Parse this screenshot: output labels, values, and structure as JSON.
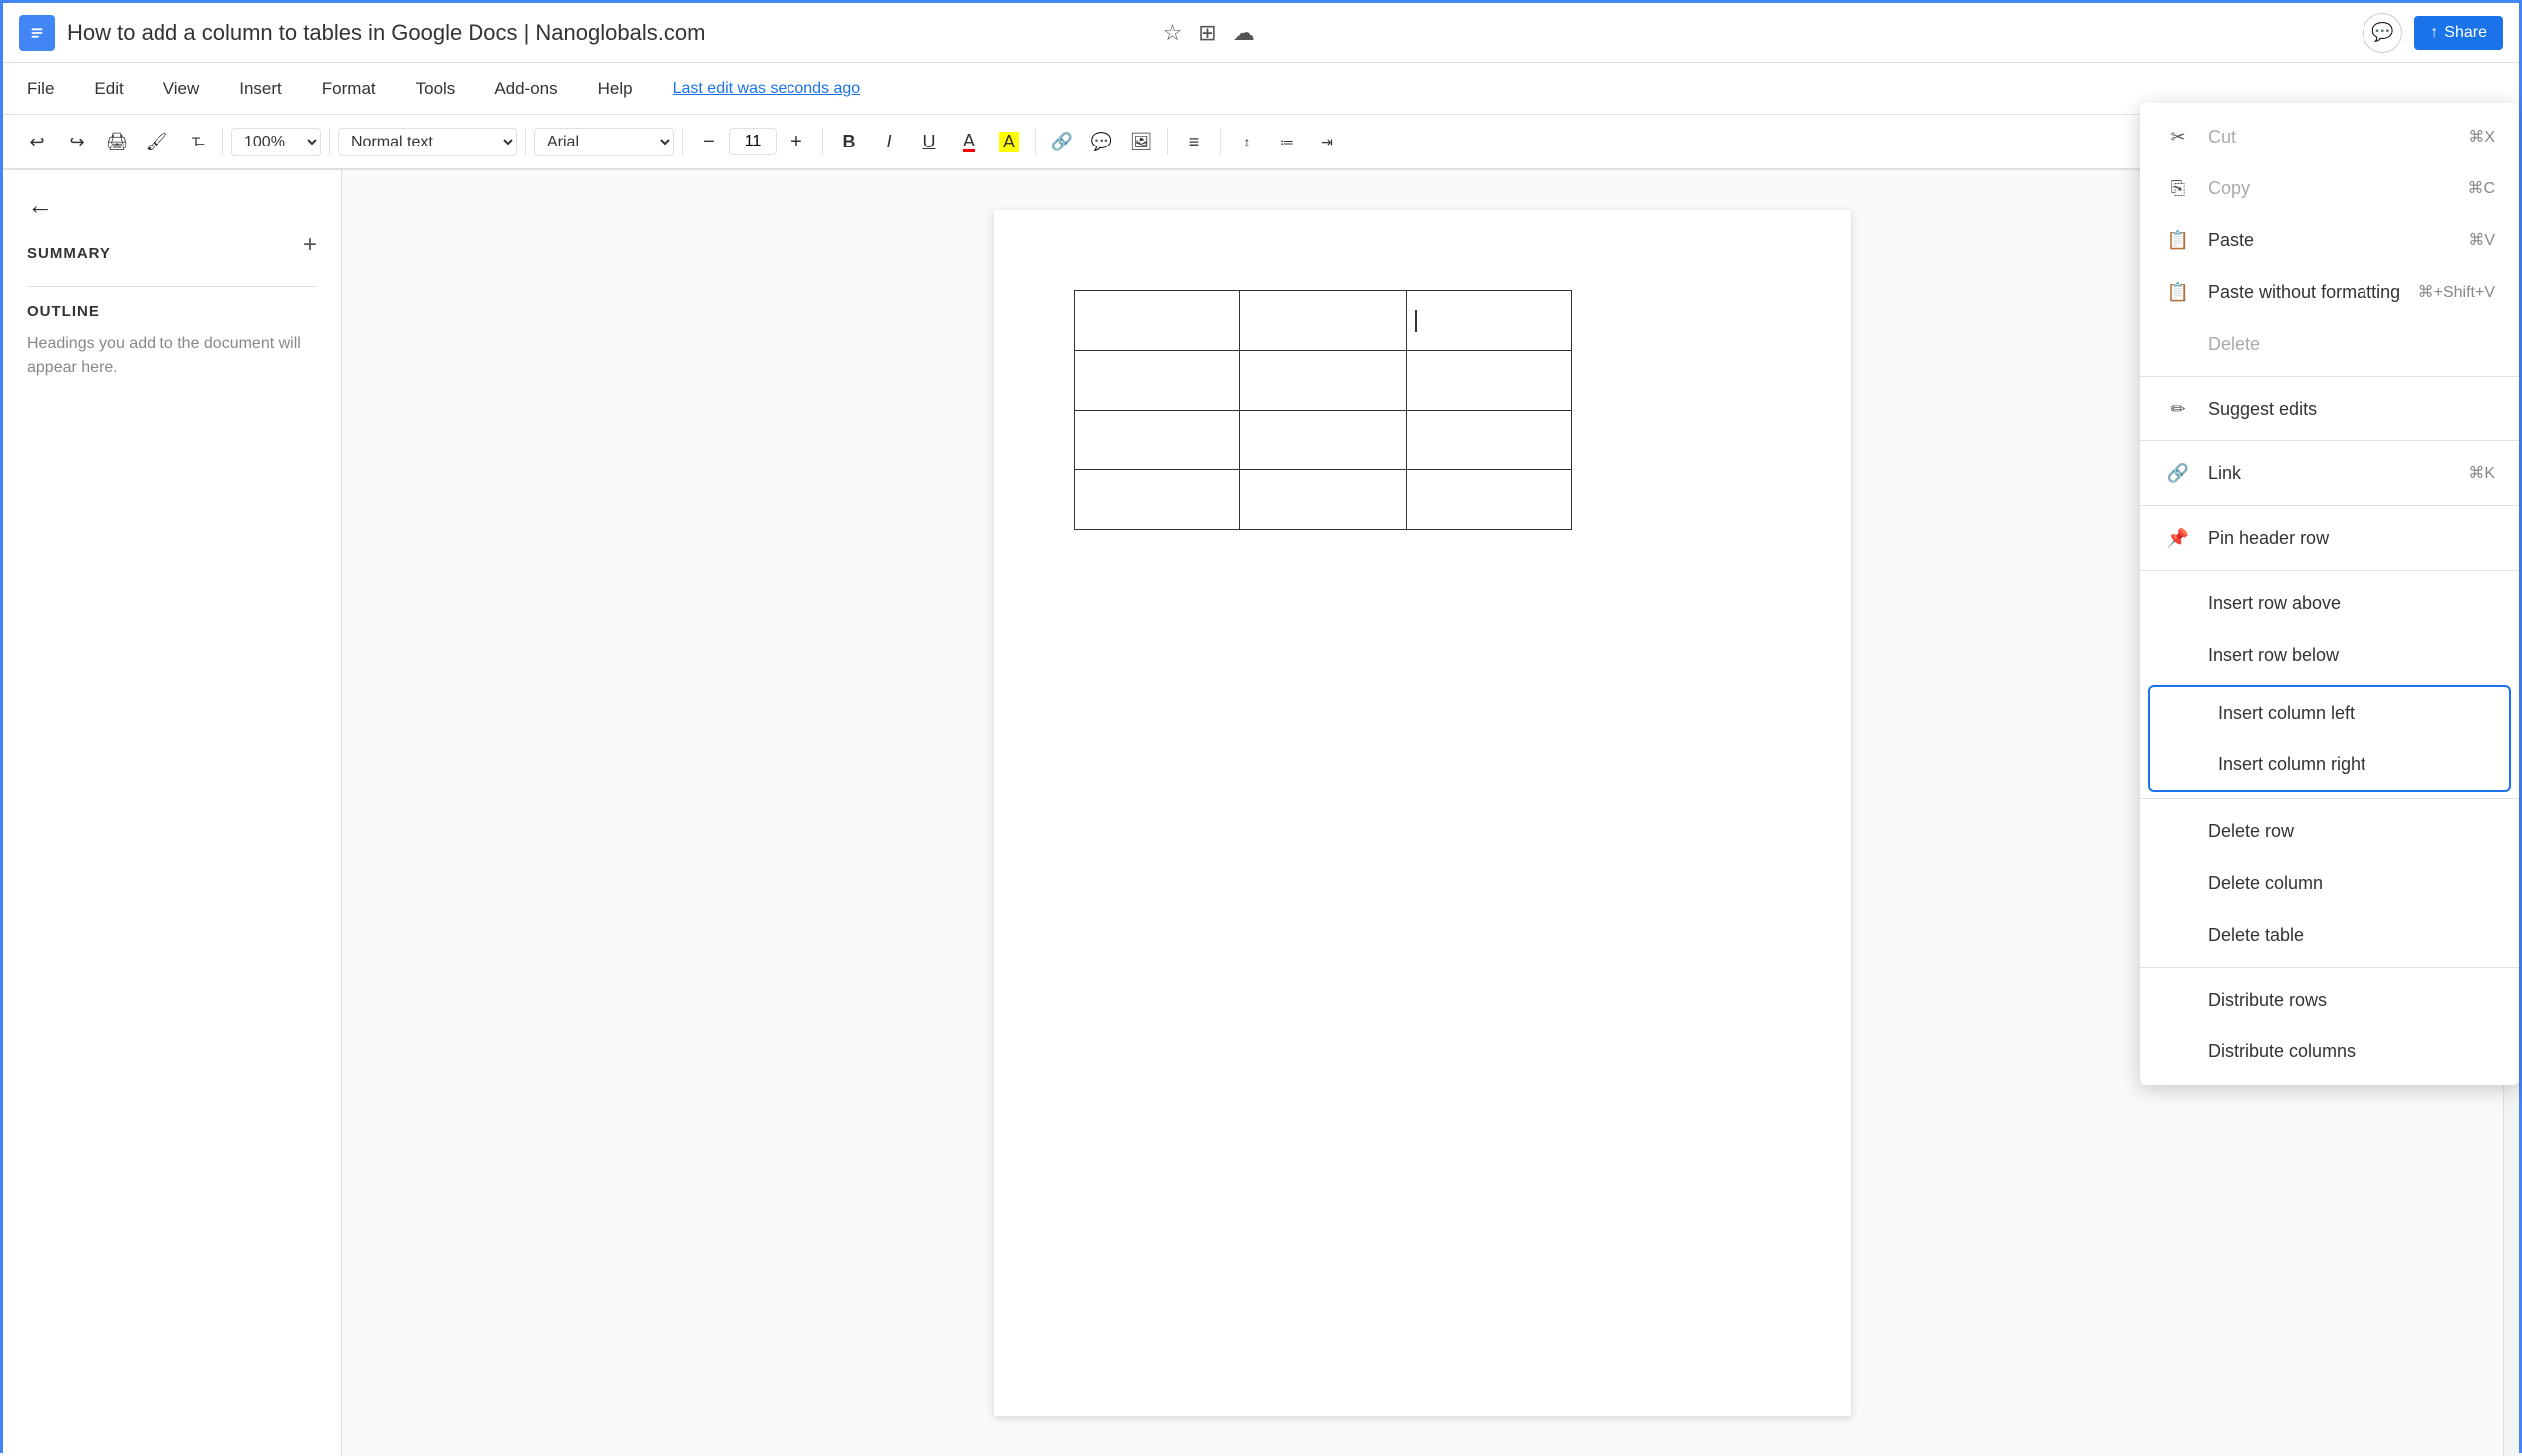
{
  "window": {
    "title": "How to add a column to tables in Google Docs | Nanoglobals.com",
    "last_edit": "Last edit was seconds ago"
  },
  "menubar": {
    "items": [
      "File",
      "Edit",
      "View",
      "Insert",
      "Format",
      "Tools",
      "Add-ons",
      "Help"
    ]
  },
  "toolbar": {
    "zoom": "100%",
    "style": "Normal text",
    "font": "Arial",
    "font_size": "11",
    "undo_label": "↩",
    "redo_label": "↪"
  },
  "sidebar": {
    "summary_label": "SUMMARY",
    "outline_label": "OUTLINE",
    "outline_hint": "Headings you add to the document will appear here."
  },
  "context_menu": {
    "items": [
      {
        "id": "cut",
        "icon": "✂",
        "label": "Cut",
        "shortcut": "⌘X",
        "disabled": true
      },
      {
        "id": "copy",
        "icon": "⎘",
        "label": "Copy",
        "shortcut": "⌘C",
        "disabled": true
      },
      {
        "id": "paste",
        "icon": "📋",
        "label": "Paste",
        "shortcut": "⌘V",
        "disabled": false
      },
      {
        "id": "paste-no-format",
        "icon": "📋",
        "label": "Paste without formatting",
        "shortcut": "⌘+Shift+V",
        "disabled": false
      },
      {
        "id": "delete",
        "icon": "",
        "label": "Delete",
        "shortcut": "",
        "disabled": true
      },
      {
        "id": "suggest-edits",
        "icon": "✏",
        "label": "Suggest edits",
        "shortcut": "",
        "disabled": false
      },
      {
        "id": "link",
        "icon": "🔗",
        "label": "Link",
        "shortcut": "⌘K",
        "disabled": false
      },
      {
        "id": "pin-header",
        "icon": "📌",
        "label": "Pin header row",
        "shortcut": "",
        "disabled": false
      },
      {
        "id": "insert-row-above",
        "icon": "",
        "label": "Insert row above",
        "shortcut": "",
        "disabled": false
      },
      {
        "id": "insert-row-below",
        "icon": "",
        "label": "Insert row below",
        "shortcut": "",
        "disabled": false
      },
      {
        "id": "insert-col-left",
        "icon": "",
        "label": "Insert column left",
        "shortcut": "",
        "disabled": false,
        "highlighted": true
      },
      {
        "id": "insert-col-right",
        "icon": "",
        "label": "Insert column right",
        "shortcut": "",
        "disabled": false,
        "highlighted": true
      },
      {
        "id": "delete-row",
        "icon": "",
        "label": "Delete row",
        "shortcut": "",
        "disabled": false
      },
      {
        "id": "delete-column",
        "icon": "",
        "label": "Delete column",
        "shortcut": "",
        "disabled": false
      },
      {
        "id": "delete-table",
        "icon": "",
        "label": "Delete table",
        "shortcut": "",
        "disabled": false
      },
      {
        "id": "distribute-rows",
        "icon": "",
        "label": "Distribute rows",
        "shortcut": "",
        "disabled": false
      },
      {
        "id": "distribute-columns",
        "icon": "",
        "label": "Distribute columns",
        "shortcut": "",
        "disabled": false
      }
    ]
  }
}
